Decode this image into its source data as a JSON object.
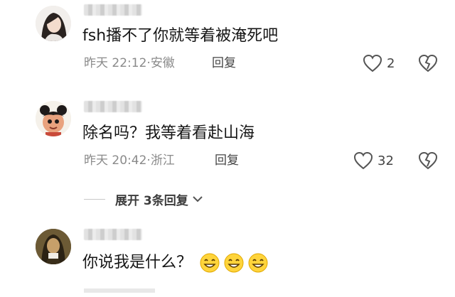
{
  "comments": [
    {
      "text": "fsh播不了你就等着被淹死吧",
      "time": "昨天 22:12",
      "location": "安徽",
      "reply_label": "回复",
      "likes": "2",
      "avatar_icon": "woman-portrait-avatar"
    },
    {
      "text": "除名吗？我等着看赴山海",
      "time": "昨天 20:42",
      "location": "浙江",
      "reply_label": "回复",
      "likes": "32",
      "avatar_icon": "cartoon-character-avatar"
    },
    {
      "text": "你说我是什么？",
      "emojis": [
        "grin-emoji",
        "grin-emoji",
        "grin-emoji"
      ],
      "avatar_icon": "mona-lisa-avatar"
    }
  ],
  "expand": {
    "label": "展开 3条回复"
  },
  "separator": "·",
  "colors": {
    "meta_text": "#8a8a8a",
    "body_text": "#161616",
    "icon_stroke": "#555555"
  }
}
